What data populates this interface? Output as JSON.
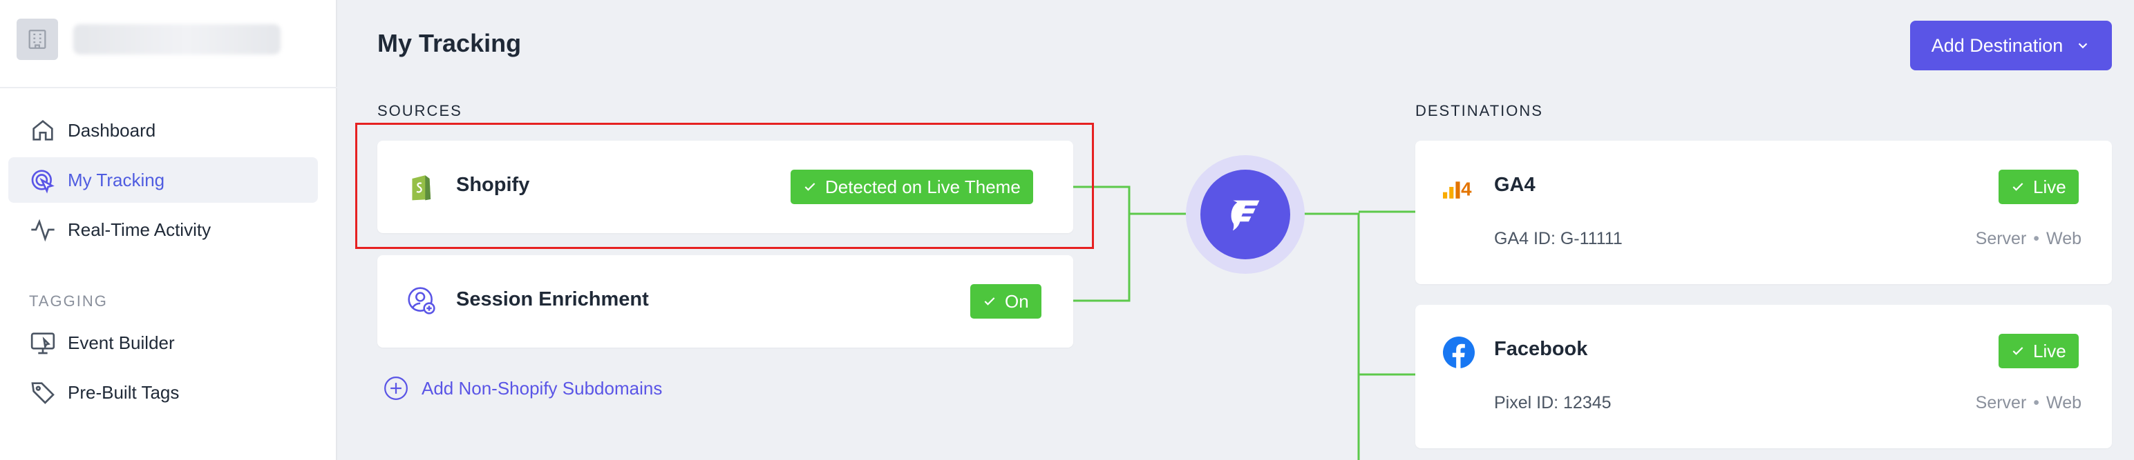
{
  "sidebar": {
    "nav": [
      {
        "label": "Dashboard",
        "icon": "home-icon"
      },
      {
        "label": "My Tracking",
        "icon": "target-icon",
        "active": true
      },
      {
        "label": "Real-Time Activity",
        "icon": "activity-icon"
      }
    ],
    "tagging_label": "TAGGING",
    "tagging": [
      {
        "label": "Event Builder",
        "icon": "monitor-icon"
      },
      {
        "label": "Pre-Built Tags",
        "icon": "tag-icon"
      }
    ]
  },
  "header": {
    "title": "My Tracking",
    "add_destination_label": "Add Destination"
  },
  "sources": {
    "heading": "SOURCES",
    "items": [
      {
        "name": "Shopify",
        "status": "Detected on Live Theme",
        "icon": "shopify-icon"
      },
      {
        "name": "Session Enrichment",
        "status": "On",
        "icon": "user-plus-icon"
      }
    ],
    "add_link": "Add Non-Shopify Subdomains"
  },
  "destinations": {
    "heading": "DESTINATIONS",
    "items": [
      {
        "name": "GA4",
        "id_text": "GA4 ID: G-11111",
        "status": "Live",
        "modes": [
          "Server",
          "Web"
        ],
        "icon": "ga4-icon"
      },
      {
        "name": "Facebook",
        "id_text": "Pixel ID: 12345",
        "status": "Live",
        "modes": [
          "Server",
          "Web"
        ],
        "icon": "facebook-icon"
      }
    ]
  },
  "colors": {
    "accent": "#5a55e6",
    "live_green": "#4dc63d",
    "connector_green": "#5cc94a",
    "highlight_red": "#e62121"
  }
}
